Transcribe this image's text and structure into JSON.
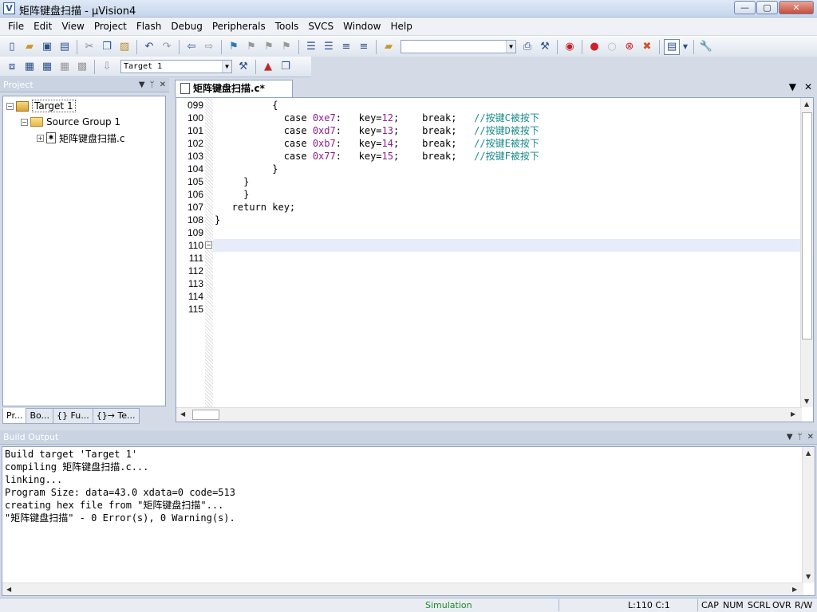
{
  "window": {
    "title": "矩阵键盘扫描 - µVision4",
    "controls": {
      "minimize": "—",
      "maximize": "▢",
      "close": "✕"
    }
  },
  "menu": [
    "File",
    "Edit",
    "View",
    "Project",
    "Flash",
    "Debug",
    "Peripherals",
    "Tools",
    "SVCS",
    "Window",
    "Help"
  ],
  "toolbar2": {
    "target_select": "Target 1"
  },
  "project_panel": {
    "title": "Project",
    "tree": {
      "target": "Target 1",
      "group": "Source Group 1",
      "file": "矩阵键盘扫描.c"
    },
    "tabs": [
      "Pr...",
      "Bo...",
      "{} Fu...",
      "{}→ Te..."
    ]
  },
  "editor": {
    "tab_label": "矩阵键盘扫描.c*",
    "lines": [
      {
        "no": "099",
        "code": "          {"
      },
      {
        "no": "100",
        "code": "            case ",
        "num": "0xe7",
        "rest": ":   key=",
        "num2": "12",
        "rest2": ";    break;   ",
        "cmt": "//按键C被按下"
      },
      {
        "no": "101",
        "code": "            case ",
        "num": "0xd7",
        "rest": ":   key=",
        "num2": "13",
        "rest2": ";    break;   ",
        "cmt": "//按键D被按下"
      },
      {
        "no": "102",
        "code": "            case ",
        "num": "0xb7",
        "rest": ":   key=",
        "num2": "14",
        "rest2": ";    break;   ",
        "cmt": "//按键E被按下"
      },
      {
        "no": "103",
        "code": "            case ",
        "num": "0x77",
        "rest": ":   key=",
        "num2": "15",
        "rest2": ";    break;   ",
        "cmt": "//按键F被按下"
      },
      {
        "no": "104",
        "code": "          }"
      },
      {
        "no": "105",
        "code": "     }"
      },
      {
        "no": "106",
        "code": "     }"
      },
      {
        "no": "107",
        "code": "   return key;"
      },
      {
        "no": "108",
        "code": "}"
      },
      {
        "no": "109",
        "code": ""
      },
      {
        "no": "110",
        "code": ""
      },
      {
        "no": "111",
        "code": ""
      },
      {
        "no": "112",
        "code": ""
      },
      {
        "no": "113",
        "code": ""
      },
      {
        "no": "114",
        "code": ""
      },
      {
        "no": "115",
        "code": ""
      }
    ]
  },
  "build_output": {
    "title": "Build Output",
    "lines": [
      "Build target 'Target 1'",
      "compiling 矩阵键盘扫描.c...",
      "linking...",
      "Program Size: data=43.0 xdata=0 code=513",
      "creating hex file from \"矩阵键盘扫描\"...",
      "\"矩阵键盘扫描\" - 0 Error(s), 0 Warning(s)."
    ]
  },
  "status": {
    "mode": "Simulation",
    "position": "L:110 C:1",
    "cap": "CAP",
    "num": "NUM",
    "scrl": "SCRL",
    "ovr": "OVR",
    "rw": "R/W"
  },
  "colors": {
    "number": "#8a1d8a",
    "comment": "#1a8a8a",
    "simulation": "#1a8a2a",
    "current_line": "#e8ecfa"
  }
}
